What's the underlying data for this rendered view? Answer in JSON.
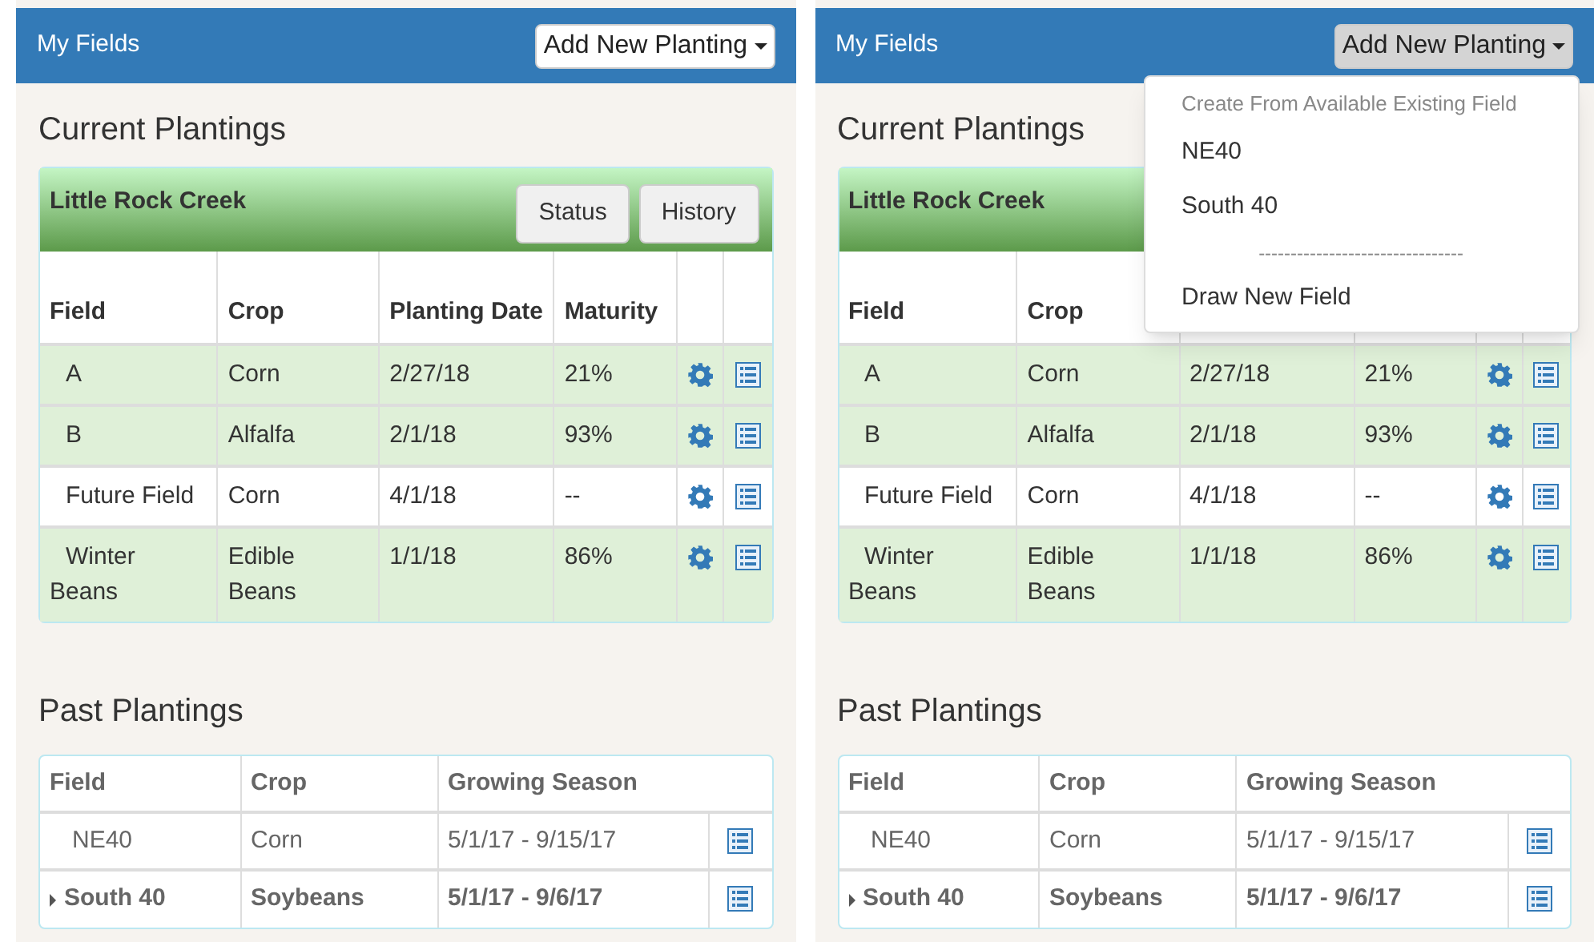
{
  "panels": [
    {
      "navbar": {
        "title": "My Fields",
        "button": "Add New Planting",
        "menu_open": false
      },
      "current": {
        "heading": "Current Plantings",
        "card_title": "Little Rock Creek",
        "buttons": [
          "Status",
          "History"
        ],
        "columns": [
          "Field",
          "Crop",
          "Planting Date",
          "Maturity"
        ],
        "rows": [
          {
            "field": "A",
            "crop": "Corn",
            "date": "2/27/18",
            "maturity": "21%",
            "highlighted": true
          },
          {
            "field": "B",
            "crop": "Alfalfa",
            "date": "2/1/18",
            "maturity": "93%",
            "highlighted": true
          },
          {
            "field": "Future Field",
            "crop": "Corn",
            "date": "4/1/18",
            "maturity": "--",
            "highlighted": false
          },
          {
            "field": "Winter Beans",
            "crop": "Edible Beans",
            "date": "1/1/18",
            "maturity": "86%",
            "highlighted": true
          }
        ]
      },
      "past": {
        "heading": "Past Plantings",
        "columns": [
          "Field",
          "Crop",
          "Growing Season"
        ],
        "rows": [
          {
            "kind": "plain",
            "field": "NE40",
            "crop": "Corn",
            "season": "5/1/17 - 9/15/17"
          },
          {
            "kind": "group",
            "field": "South 40",
            "crop": "Soybeans",
            "season": "5/1/17 - 9/6/17"
          }
        ]
      }
    },
    {
      "navbar": {
        "title": "My Fields",
        "button": "Add New Planting",
        "menu_open": true
      },
      "menu": [
        {
          "kind": "header",
          "label": "Create From Available Existing Field"
        },
        {
          "kind": "item",
          "label": "NE40"
        },
        {
          "kind": "item",
          "label": "South 40"
        },
        {
          "kind": "divider",
          "label": "--------------------------------"
        },
        {
          "kind": "item",
          "label": "Draw New Field"
        }
      ],
      "current": {
        "heading": "Current Plantings",
        "card_title": "Little Rock Creek",
        "columns": [
          "Field",
          "Crop"
        ],
        "rows": [
          {
            "field": "A",
            "crop": "Corn",
            "date": "2/27/18",
            "maturity": "21%",
            "highlighted": true
          },
          {
            "field": "B",
            "crop": "Alfalfa",
            "date": "2/1/18",
            "maturity": "93%",
            "highlighted": true
          },
          {
            "field": "Future Field",
            "crop": "Corn",
            "date": "4/1/18",
            "maturity": "--",
            "highlighted": false
          },
          {
            "field": "Winter Beans",
            "crop": "Edible Beans",
            "date": "1/1/18",
            "maturity": "86%",
            "highlighted": true
          }
        ]
      },
      "past": {
        "heading": "Past Plantings",
        "columns": [
          "Field",
          "Crop",
          "Growing Season"
        ],
        "rows": [
          {
            "kind": "plain",
            "field": "NE40",
            "crop": "Corn",
            "season": "5/1/17 - 9/15/17"
          },
          {
            "kind": "group",
            "field": "South 40",
            "crop": "Soybeans",
            "season": "5/1/17 - 9/6/17"
          }
        ]
      }
    }
  ]
}
